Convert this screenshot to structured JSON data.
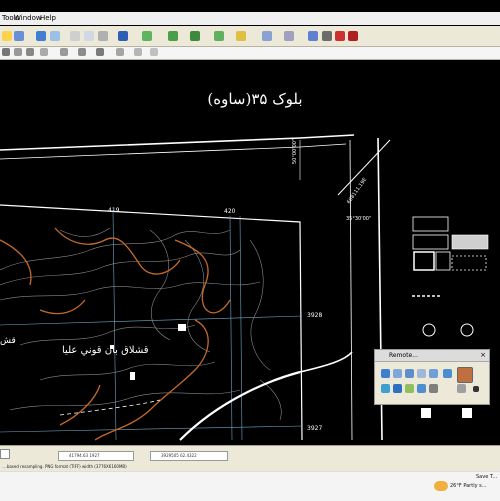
{
  "menubar": {
    "items": [
      "Tools",
      "Window",
      "Help"
    ]
  },
  "map": {
    "title": "بلوک ۳۵(ساوه)",
    "place_label": "قشلاق بان قوني عليا",
    "left_partial_label": "قش",
    "grid_top": [
      "419",
      "420"
    ],
    "grid_right": [
      "3928",
      "3927"
    ],
    "coord_vertical": "50°00'00\"",
    "coord_corner": "608111.19E",
    "coord_lat": "35°30'00\"",
    "colors": {
      "contour_index": "#c46a2a",
      "contour": "#8a8a8a",
      "grid": "#6fa8c8",
      "frame": "#ffffff"
    }
  },
  "status": {
    "left_text": "...based resampling. PNG format (TIFF) width (3776X6160MB)",
    "coord1": "41794.63 1927",
    "coord2": "3929505 62.4322"
  },
  "floating_toolbar": {
    "title": "Remote..."
  },
  "taskbar": {
    "weather": "26°F  Partly s...",
    "right_text": "Save T..."
  },
  "icons": [
    "folder-icon",
    "save-icon",
    "print-icon",
    "cut-icon",
    "copy-icon",
    "paste-icon",
    "undo-icon",
    "redo-icon",
    "add-data-icon",
    "zoom-in-icon",
    "zoom-out-icon",
    "pan-icon",
    "full-extent-icon",
    "identify-icon",
    "find-icon",
    "measure-icon",
    "hyperlink-icon",
    "layout-icon",
    "help-icon"
  ]
}
